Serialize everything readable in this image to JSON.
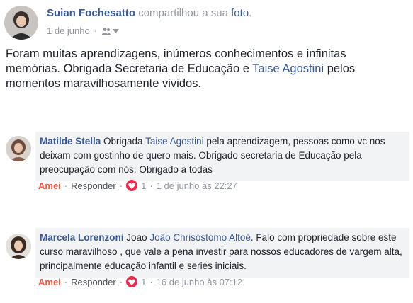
{
  "post": {
    "author": "Suian Fochesatto",
    "action_text": "compartilhou a sua",
    "action_link": "foto",
    "action_period": ".",
    "date": "1 de junho",
    "separator": "·",
    "privacy_icon": "friends-icon",
    "text_before_link": "Foram muitas aprendizagens, inúmeros conhecimentos e  infinitas memórias. Obrigada Secretaria de Educação e ",
    "text_link": "Taise Agostini",
    "text_after_link": " pelos momentos maravilhosamente vividos."
  },
  "comments": [
    {
      "author": "Matilde Stella",
      "text_before_link": " Obrigada ",
      "text_link": "Taise Agostini",
      "text_after_link": " pela aprendizagem, pessoas como vc nos deixam com gostinho de quero mais. Obrigado secretaria de Educação pela preocupação com nós. Obrigado a todas",
      "like_label": "Amei",
      "reply_label": "Responder",
      "reaction_count": "1",
      "timestamp": "1 de junho às 22:27",
      "dot": "·"
    },
    {
      "author": "Marcela Lorenzoni",
      "text_before_link": " Joao ",
      "text_link": "João Chrisóstomo Altoé",
      "text_after_link": ". Falo com propriedade sobre este curso maravilhoso , que vale a pena investir para nossos educadores de vargem alta, principalmente educação infantil e series iniciais.",
      "like_label": "Amei",
      "reply_label": "Responder",
      "reaction_count": "1",
      "timestamp": "16 de junho às 07:12",
      "dot": "·"
    }
  ],
  "colors": {
    "link": "#365899",
    "meta_gray": "#90949c",
    "love": "#f5533d",
    "heart_badge": "#f0284a",
    "bubble": "#f2f3f5"
  }
}
